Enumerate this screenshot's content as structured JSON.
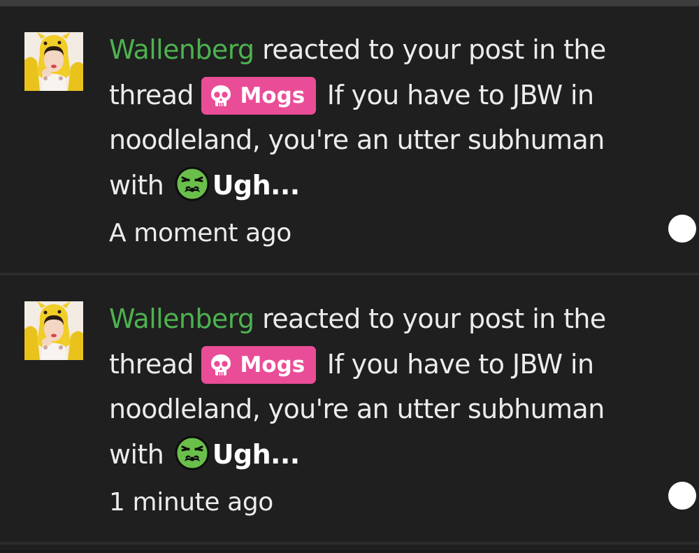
{
  "notifications": [
    {
      "user": "Wallenberg",
      "action_text": "reacted to your post in the thread",
      "prefix_label": "Mogs",
      "thread_title": "If you have to JBW in noodleland, you're an utter subhuman",
      "with_text": "with",
      "reaction_name": "Ugh...",
      "time": "A moment ago"
    },
    {
      "user": "Wallenberg",
      "action_text": "reacted to your post in the thread",
      "prefix_label": "Mogs",
      "thread_title": "If you have to JBW in noodleland, you're an utter subhuman",
      "with_text": "with",
      "reaction_name": "Ugh...",
      "time": "1 minute ago"
    }
  ],
  "colors": {
    "background": "#1f1f1f",
    "username": "#4db24f",
    "prefix_badge": "#ea4d97",
    "reaction_face": "#6abf4b",
    "unread_dot": "#ffffff"
  },
  "icons": {
    "prefix": "skull-icon",
    "reaction": "nauseated-face-icon"
  }
}
